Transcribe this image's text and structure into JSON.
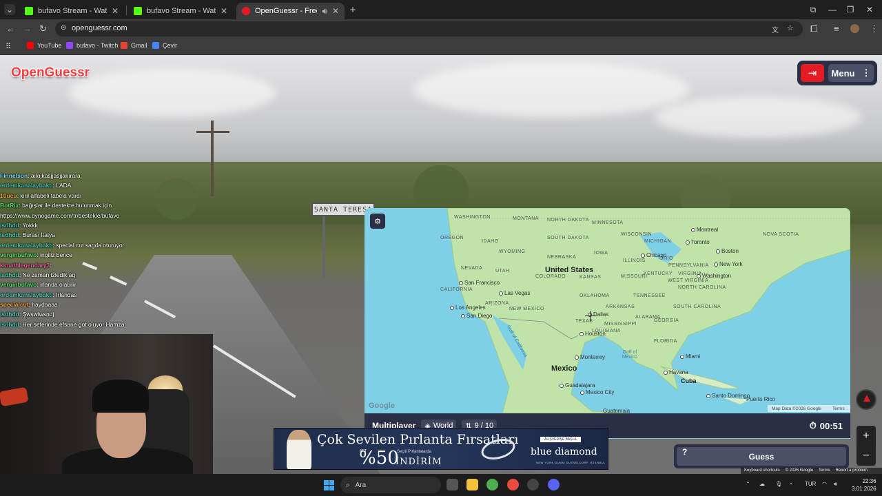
{
  "browser": {
    "tabs": [
      {
        "title": "bufavo Stream - Watch Live on",
        "active": false
      },
      {
        "title": "bufavo Stream - Watch Live on",
        "active": false
      },
      {
        "title": "OpenGuessr - Free GeoGue",
        "active": true
      }
    ],
    "url": "openguessr.com",
    "bookmarks": [
      {
        "label": "YouTube",
        "icon": "youtube-icon",
        "color": "#ff0000"
      },
      {
        "label": "bufavo - Twitch",
        "icon": "twitch-icon",
        "color": "#9146ff"
      },
      {
        "label": "Gmail",
        "icon": "gmail-icon",
        "color": "#ea4335"
      },
      {
        "label": "Çevir",
        "icon": "translate-icon",
        "color": "#4285f4"
      }
    ]
  },
  "game": {
    "logo": "OpenGuessr",
    "menu_label": "Menu",
    "road_sign": "SANTA TERESA",
    "mode": "Multiplayer",
    "map_scope": "World",
    "round": "9 / 10",
    "timer": "00:51",
    "guess_label": "Guess",
    "help_label": "?",
    "accent": "#e31b23",
    "panel_color": "#2b2f45"
  },
  "map": {
    "countries": [
      "United States",
      "Mexico",
      "Cuba"
    ],
    "regions": [
      "WASHINGTON",
      "MONTANA",
      "NORTH DAKOTA",
      "MINNESOTA",
      "OREGON",
      "IDAHO",
      "SOUTH DAKOTA",
      "WISCONSIN",
      "MICHIGAN",
      "WYOMING",
      "IOWA",
      "NEBRASKA",
      "ILLINOIS",
      "OHIO",
      "NEVADA",
      "UTAH",
      "COLORADO",
      "KANSAS",
      "MISSOURI",
      "KENTUCKY",
      "VIRGINIA",
      "CALIFORNIA",
      "ARIZONA",
      "OKLAHOMA",
      "TENNESSEE",
      "NORTH CAROLINA",
      "NEW MEXICO",
      "ARKANSAS",
      "SOUTH CAROLINA",
      "MISSISSIPPI",
      "ALABAMA",
      "GEORGIA",
      "TEXAS",
      "LOUISIANA",
      "FLORIDA",
      "NOVA SCOTIA",
      "PENNSYLVANIA",
      "WEST VIRGINIA"
    ],
    "cities": [
      "San Francisco",
      "Los Angeles",
      "San Diego",
      "Las Vegas",
      "Dallas",
      "Houston",
      "Chicago",
      "Toronto",
      "Montreal",
      "Boston",
      "New York",
      "Washington",
      "Miami",
      "Havana",
      "Monterrey",
      "Guadalajara",
      "Mexico City",
      "Santo Domingo",
      "Puerto Rico",
      "Guatemala"
    ],
    "waters": [
      "Gulf of California",
      "Gulf of Mexico"
    ],
    "google": "Google",
    "attribution": "Map Data ©2026 Google",
    "terms": "Terms"
  },
  "footer": {
    "shortcuts": "Keyboard shortcuts",
    "data": "© 2026 Google",
    "terms": "Terms",
    "report": "Report a problem"
  },
  "chat": [
    {
      "user": "Finnelson",
      "text": ": aıkıjkasjjasjjakırara",
      "color": "#7fd3ff"
    },
    {
      "user": "erdemkanalaybaktı",
      "text": ": LADA",
      "color": "#45c4b0"
    },
    {
      "user": "10ucu",
      "text": ": kiril alfabeli tabela vardı",
      "color": "#f2a23a"
    },
    {
      "user": "BotRix",
      "text": ": bağışlar ile destekte bulunmak için",
      "color": "#53d769"
    },
    {
      "user": "",
      "text": "https://www.bynogame.com/tr/destekle/bufavo",
      "color": "#ffffff"
    },
    {
      "user": "isdhdd",
      "text": ": Yokkk",
      "color": "#45c4b0"
    },
    {
      "user": "isdhdd",
      "text": ": Burası İtalya",
      "color": "#45c4b0"
    },
    {
      "user": "erdemkanalaybaktı",
      "text": ": special cut sagda oturuyor",
      "color": "#45c4b0"
    },
    {
      "user": "verginbufavo",
      "text": ": ingiliz bence",
      "color": "#53d769"
    },
    {
      "user": "klmathlegendary3",
      "text": ":",
      "color": "#e05b9b"
    },
    {
      "user": "isdhdd",
      "text": ": Ne zaman izledik aq",
      "color": "#45c4b0"
    },
    {
      "user": "verginbufavo",
      "text": ": irlanda olabilir",
      "color": "#53d769"
    },
    {
      "user": "erdemkanalaybaktı",
      "text": ": Irlandas",
      "color": "#45c4b0"
    },
    {
      "user": "specialcut",
      "text": ": haydaaaa",
      "color": "#f2a23a"
    },
    {
      "user": "isdhdd",
      "text": ": Şwşwlwsndj",
      "color": "#45c4b0"
    },
    {
      "user": "isdhdd",
      "text": ": Her seferinde efsane got oluyor Hamza",
      "color": "#45c4b0"
    }
  ],
  "ad": {
    "headline": "Çok Sevilen Pırlanta Fırsatları",
    "net": "NET",
    "percent": "%50",
    "subtitle": "Seçili Pırlantalarda",
    "discount": "İNDİRİM",
    "badge": "ALIŞVERİŞE BAŞLA",
    "brand": "blue diamond",
    "cities": "NEW YORK DUBAI DUSSELDORF ISTANBUL"
  },
  "taskbar": {
    "search_placeholder": "Ara",
    "language": "TUR",
    "time": "22:36",
    "date": "3.01.2026"
  }
}
